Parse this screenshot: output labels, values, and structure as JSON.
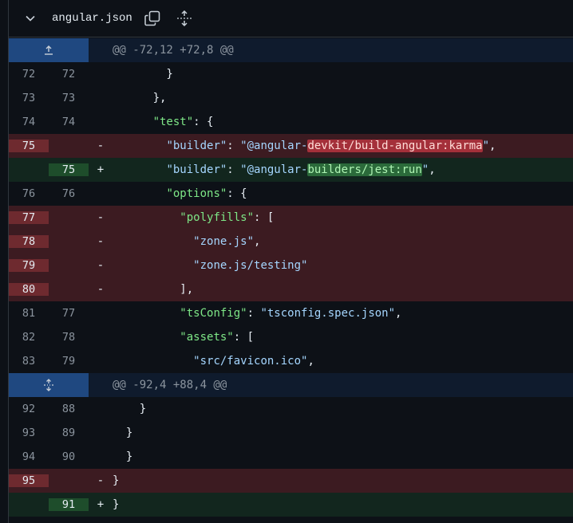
{
  "file": {
    "name": "angular.json",
    "icons": [
      "chevron-down-icon",
      "copy-icon",
      "expand-all-icon"
    ]
  },
  "hunks": [
    {
      "header": "@@ -72,12 +72,8 @@"
    },
    {
      "header": "@@ -92,4 +88,4 @@"
    }
  ],
  "lines": {
    "l72": {
      "old": "72",
      "new": "72",
      "text": "        }"
    },
    "l73": {
      "old": "73",
      "new": "73",
      "text": "      },"
    },
    "l74": {
      "old": "74",
      "new": "74",
      "k": "\"test\"",
      "rest": ": {"
    },
    "l75d": {
      "old": "75",
      "sign": "-",
      "k": "\"builder\"",
      "p1": ": ",
      "s1": "\"@angular-",
      "hl": "devkit/build-angular:karma",
      "s2": "\"",
      "p2": ","
    },
    "l75a": {
      "new": "75",
      "sign": "+",
      "k": "\"builder\"",
      "p1": ": ",
      "s1": "\"@angular-",
      "hl": "builders/jest:run",
      "s2": "\"",
      "p2": ","
    },
    "l76": {
      "old": "76",
      "new": "76",
      "k": "\"options\"",
      "rest": ": {"
    },
    "l77": {
      "old": "77",
      "sign": "-",
      "k": "\"polyfills\"",
      "rest": ": ["
    },
    "l78": {
      "old": "78",
      "sign": "-",
      "s": "\"zone.js\"",
      "rest": ","
    },
    "l79": {
      "old": "79",
      "sign": "-",
      "s": "\"zone.js/testing\""
    },
    "l80": {
      "old": "80",
      "sign": "-",
      "text": "          ],"
    },
    "l81": {
      "old": "81",
      "new": "77",
      "k": "\"tsConfig\"",
      "p1": ": ",
      "s": "\"tsconfig.spec.json\"",
      "rest": ","
    },
    "l82": {
      "old": "82",
      "new": "78",
      "k": "\"assets\"",
      "rest": ": ["
    },
    "l83": {
      "old": "83",
      "new": "79",
      "s": "\"src/favicon.ico\"",
      "rest": ","
    },
    "l92": {
      "old": "92",
      "new": "88",
      "text": "    }"
    },
    "l93": {
      "old": "93",
      "new": "89",
      "text": "  }"
    },
    "l94": {
      "old": "94",
      "new": "90",
      "text": "}"
    },
    "l95": {
      "old": "95",
      "sign": "-",
      "text": "}"
    },
    "l91": {
      "new": "91",
      "sign": "+",
      "text": "}"
    }
  }
}
